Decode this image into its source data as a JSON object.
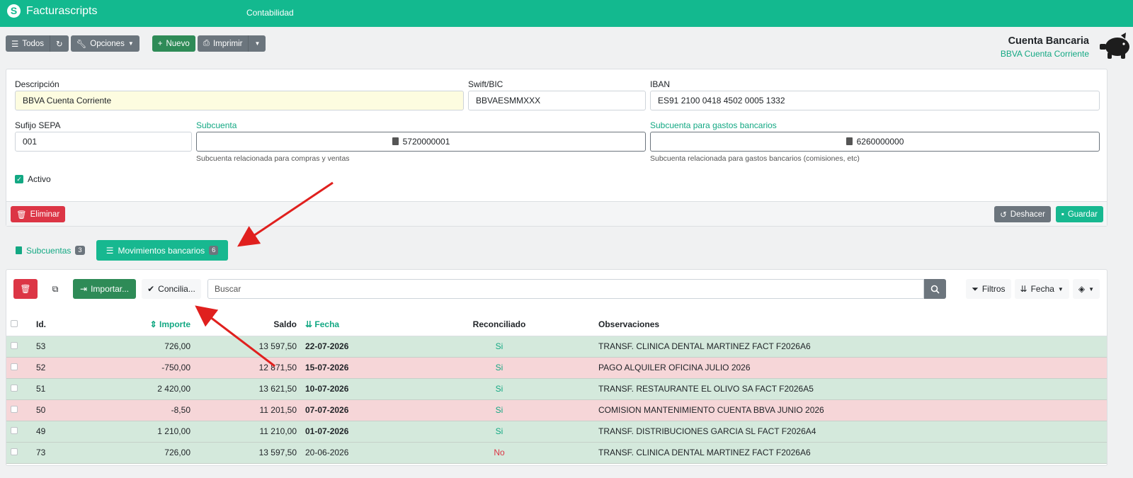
{
  "navbar": {
    "brand": "Facturascripts",
    "menu_item": "Contabilidad",
    "bg_color": "#13b98f"
  },
  "toolbar": {
    "all_label": "Todos",
    "options_label": "Opciones",
    "new_label": "Nuevo",
    "print_label": "Imprimir"
  },
  "header": {
    "title": "Cuenta Bancaria",
    "subtitle": "BBVA Cuenta Corriente"
  },
  "form": {
    "descripcion_label": "Descripción",
    "descripcion_value": "BBVA Cuenta Corriente",
    "swift_label": "Swift/BIC",
    "swift_value": "BBVAESMMXXX",
    "iban_label": "IBAN",
    "iban_value": "ES91 2100 0418 4502 0005 1332",
    "sepa_label": "Sufijo SEPA",
    "sepa_value": "001",
    "subcuenta_label": "Subcuenta",
    "subcuenta_value": "5720000001",
    "subcuenta_help": "Subcuenta relacionada para compras y ventas",
    "gastos_label": "Subcuenta para gastos bancarios",
    "gastos_value": "6260000000",
    "gastos_help": "Subcuenta relacionada para gastos bancarios (comisiones, etc)",
    "activo_label": "Activo",
    "activo_checked": true,
    "delete_label": "Eliminar",
    "undo_label": "Deshacer",
    "save_label": "Guardar"
  },
  "tabs": [
    {
      "label": "Subcuentas",
      "count": "3",
      "active": false
    },
    {
      "label": "Movimientos bancarios",
      "count": "6",
      "active": true
    }
  ],
  "list": {
    "import_label": "Importar...",
    "reconcile_label": "Concilia...",
    "search_placeholder": "Buscar",
    "filters_label": "Filtros",
    "sort_label": "Fecha",
    "columns": {
      "id": "Id.",
      "importe": "Importe",
      "saldo": "Saldo",
      "fecha": "Fecha",
      "reconciliado": "Reconciliado",
      "observaciones": "Observaciones"
    },
    "rows": [
      {
        "id": "53",
        "importe": "726,00",
        "saldo": "13 597,50",
        "fecha": "22-07-2026",
        "reconciliado": "Si",
        "observaciones": "TRANSF. CLINICA DENTAL MARTINEZ FACT F2026A6"
      },
      {
        "id": "52",
        "importe": "-750,00",
        "saldo": "12 871,50",
        "fecha": "15-07-2026",
        "reconciliado": "Si",
        "observaciones": "PAGO ALQUILER OFICINA JULIO 2026"
      },
      {
        "id": "51",
        "importe": "2 420,00",
        "saldo": "13 621,50",
        "fecha": "10-07-2026",
        "reconciliado": "Si",
        "observaciones": "TRANSF. RESTAURANTE EL OLIVO SA FACT F2026A5"
      },
      {
        "id": "50",
        "importe": "-8,50",
        "saldo": "11 201,50",
        "fecha": "07-07-2026",
        "reconciliado": "Si",
        "observaciones": "COMISION MANTENIMIENTO CUENTA BBVA JUNIO 2026"
      },
      {
        "id": "49",
        "importe": "1 210,00",
        "saldo": "11 210,00",
        "fecha": "01-07-2026",
        "reconciliado": "Si",
        "observaciones": "TRANSF. DISTRIBUCIONES GARCIA SL FACT F2026A4"
      },
      {
        "id": "73",
        "importe": "726,00",
        "saldo": "13 597,50",
        "fecha": "20-06-2026",
        "reconciliado": "No",
        "observaciones": "TRANSF. CLINICA DENTAL MARTINEZ FACT F2026A6"
      }
    ]
  }
}
